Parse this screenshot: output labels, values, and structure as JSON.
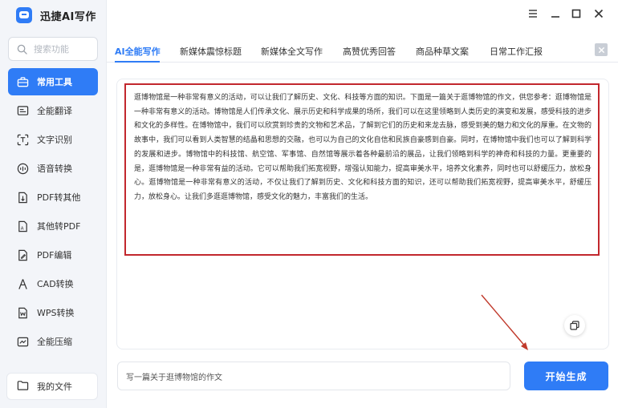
{
  "app": {
    "title": "迅捷AI写作"
  },
  "search": {
    "placeholder": "搜索功能"
  },
  "sidebar": {
    "items": [
      {
        "label": "常用工具",
        "icon": "toolbox-icon",
        "active": true
      },
      {
        "label": "全能翻译",
        "icon": "translate-icon"
      },
      {
        "label": "文字识别",
        "icon": "scan-text-icon"
      },
      {
        "label": "语音转换",
        "icon": "audio-wave-icon"
      },
      {
        "label": "PDF转其他",
        "icon": "pdf-convert-icon"
      },
      {
        "label": "其他转PDF",
        "icon": "to-pdf-icon"
      },
      {
        "label": "PDF编辑",
        "icon": "pdf-edit-icon"
      },
      {
        "label": "CAD转换",
        "icon": "cad-icon"
      },
      {
        "label": "WPS转换",
        "icon": "wps-icon"
      },
      {
        "label": "全能压缩",
        "icon": "compress-icon"
      }
    ],
    "my_files": "我的文件"
  },
  "tabs": [
    {
      "label": "AI全能写作",
      "active": true
    },
    {
      "label": "新媒体震惊标题"
    },
    {
      "label": "新媒体全文写作"
    },
    {
      "label": "高赞优秀回答"
    },
    {
      "label": "商品种草文案"
    },
    {
      "label": "日常工作汇报"
    }
  ],
  "article": {
    "text": "逛博物馆是一种非常有意义的活动，可以让我们了解历史、文化、科技等方面的知识。下面是一篇关于逛博物馆的作文，供您参考：逛博物馆是一种非常有意义的活动。博物馆是人们传承文化、展示历史和科学成果的场所，我们可以在这里领略到人类历史的演变和发展，感受科技的进步和文化的多样性。在博物馆中，我们可以欣赏到珍贵的文物和艺术品，了解到它们的历史和来龙去脉，感受到美的魅力和文化的厚重。在文物的故事中，我们可以看到人类智慧的结晶和思想的交融，也可以为自己的文化自信和民族自豪感到自豪。同时，在博物馆中我们也可以了解到科学的发展和进步。博物馆中的科技馆、航空馆、军事馆、自然馆等展示着各种最前沿的展品，让我们领略到科学的神奇和科技的力量。更重要的是，逛博物馆是一种非常有益的活动。它可以帮助我们拓宽视野，增强认知能力，提高审美水平，培养文化素养，同时也可以舒缓压力，放松身心。逛博物馆是一种非常有意义的活动，不仅让我们了解到历史、文化和科技方面的知识，还可以帮助我们拓宽视野，提高审美水平，舒缓压力，放松身心。让我们多逛逛博物馆，感受文化的魅力，丰富我们的生活。"
  },
  "prompt": {
    "value": "写一篇关于逛博物馆的作文"
  },
  "generate_button": "开始生成",
  "colors": {
    "accent": "#2f7cf6",
    "highlight_border": "#c2272d",
    "arrow": "#c0392b"
  }
}
